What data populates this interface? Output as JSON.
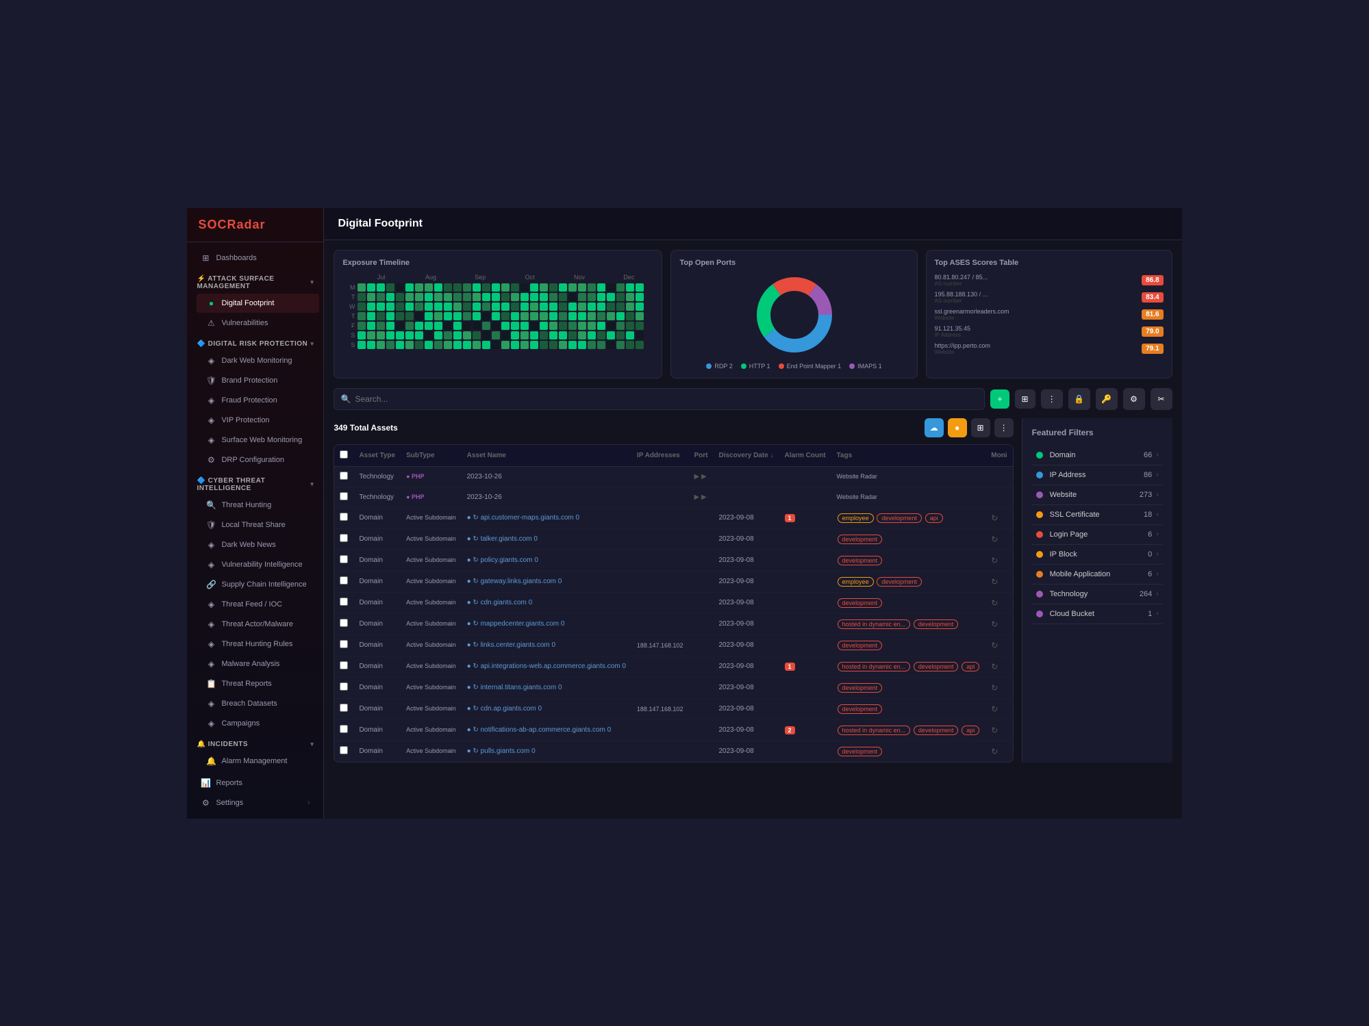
{
  "app": {
    "logo": "SOCRadar",
    "page_title": "Digital Footprint"
  },
  "sidebar": {
    "top_items": [
      {
        "id": "dashboards",
        "label": "Dashboards",
        "icon": "⊞"
      }
    ],
    "sections": [
      {
        "id": "attack-surface",
        "label": "Attack Surface Management",
        "chevron": "▾",
        "items": [
          {
            "id": "digital-footprint",
            "label": "Digital Footprint",
            "active": true
          },
          {
            "id": "vulnerabilities",
            "label": "Vulnerabilities",
            "active": false
          }
        ]
      },
      {
        "id": "digital-risk",
        "label": "Digital Risk Protection",
        "chevron": "▾",
        "items": [
          {
            "id": "dark-web",
            "label": "Dark Web Monitoring",
            "active": false
          },
          {
            "id": "brand",
            "label": "Brand Protection",
            "active": false
          },
          {
            "id": "fraud",
            "label": "Fraud Protection",
            "active": false
          },
          {
            "id": "vip",
            "label": "VIP Protection",
            "active": false
          },
          {
            "id": "surface-web",
            "label": "Surface Web Monitoring",
            "active": false
          },
          {
            "id": "drp-config",
            "label": "DRP Configuration",
            "active": false
          }
        ]
      },
      {
        "id": "cyber-threat",
        "label": "Cyber Threat Intelligence",
        "chevron": "▾",
        "items": [
          {
            "id": "threat-hunting",
            "label": "Threat Hunting",
            "active": false
          },
          {
            "id": "local-threat",
            "label": "Local Threat Share",
            "active": false
          },
          {
            "id": "dark-web-news",
            "label": "Dark Web News",
            "active": false
          },
          {
            "id": "vuln-intel",
            "label": "Vulnerability Intelligence",
            "active": false
          },
          {
            "id": "supply-chain",
            "label": "Supply Chain Intelligence",
            "active": false
          },
          {
            "id": "threat-feed",
            "label": "Threat Feed / IOC",
            "active": false
          },
          {
            "id": "threat-actor",
            "label": "Threat Actor/Malware",
            "active": false
          },
          {
            "id": "hunting-rules",
            "label": "Threat Hunting Rules",
            "active": false
          },
          {
            "id": "malware",
            "label": "Malware Analysis",
            "active": false
          },
          {
            "id": "threat-reports",
            "label": "Threat Reports",
            "active": false
          },
          {
            "id": "breach",
            "label": "Breach Datasets",
            "active": false
          },
          {
            "id": "campaigns",
            "label": "Campaigns",
            "active": false
          }
        ]
      },
      {
        "id": "incidents",
        "label": "Incidents",
        "chevron": "▾",
        "items": [
          {
            "id": "alarm-mgmt",
            "label": "Alarm Management",
            "active": false
          }
        ]
      },
      {
        "id": "reports",
        "label": "Reports",
        "chevron": ""
      },
      {
        "id": "settings",
        "label": "Settings",
        "chevron": "›"
      }
    ]
  },
  "exposure_timeline": {
    "title": "Exposure Timeline",
    "months": [
      "Jul",
      "Aug",
      "Sep",
      "Oct",
      "Nov",
      "Dec"
    ],
    "day_labels": [
      "M",
      "T",
      "W",
      "T",
      "F",
      "S",
      "S"
    ]
  },
  "top_ports": {
    "title": "Top Open Ports",
    "legend": [
      {
        "label": "RDP",
        "value": 2,
        "color": "#3498db"
      },
      {
        "label": "HTTP",
        "value": 1,
        "color": "#00c97a"
      },
      {
        "label": "End Point Mapper",
        "value": 1,
        "color": "#e74c3c"
      },
      {
        "label": "IMAPS",
        "value": 1,
        "color": "#9b59b6"
      }
    ],
    "segments": [
      {
        "color": "#3498db",
        "pct": 40
      },
      {
        "color": "#00c97a",
        "pct": 25
      },
      {
        "color": "#e74c3c",
        "pct": 20
      },
      {
        "color": "#9b59b6",
        "pct": 15
      }
    ]
  },
  "ases_table": {
    "title": "Top ASES Scores Table",
    "items": [
      {
        "address": "80.81.80.247 / 85...",
        "sublabel": "AS number",
        "score": 86.8,
        "color": "#e74c3c"
      },
      {
        "address": "195.88.188.130 / ...",
        "sublabel": "AS number",
        "score": 83.4,
        "color": "#e74c3c"
      },
      {
        "address": "ssl.greenarmorleaders.com",
        "sublabel": "Website",
        "score": 81.6,
        "color": "#e67e22"
      },
      {
        "address": "91.121.35.45",
        "sublabel": "IP Address",
        "score": 79.0,
        "color": "#e67e22"
      },
      {
        "address": "https://ipp.perto.com",
        "sublabel": "Website",
        "score": 79.1,
        "color": "#e67e22"
      }
    ]
  },
  "search": {
    "placeholder": "Search...",
    "btn_labels": {
      "add": "+",
      "filter": "⊞",
      "more": "⋮"
    }
  },
  "assets": {
    "total_label": "349 Total Assets",
    "columns": [
      "",
      "Asset Type",
      "SubType",
      "Asset Name",
      "IP Addresses",
      "Port",
      "Discovery Date ↓",
      "Alarm Count",
      "Tags",
      "Moni"
    ],
    "rows": [
      {
        "type": "Technology",
        "subtype": "● PHP",
        "name": "2023-10-26",
        "ip": "",
        "port": "",
        "date": "",
        "alarm": "",
        "tags": [
          "Website Radar"
        ],
        "source": ""
      },
      {
        "type": "Technology",
        "subtype": "● PHP",
        "name": "2023-10-26",
        "ip": "",
        "port": "",
        "date": "",
        "alarm": "",
        "tags": [
          "Website Radar"
        ],
        "source": ""
      },
      {
        "type": "Domain",
        "subtype": "Active Subdomain",
        "name": "api.customer-maps.giants.com 0",
        "ip": "",
        "port": "",
        "date": "2023-09-08",
        "alarm": "1",
        "alarm_color": "red",
        "tags": [
          "employee",
          "development",
          "api"
        ],
        "source": ""
      },
      {
        "type": "Domain",
        "subtype": "Active Subdomain",
        "name": "talker.giants.com 0",
        "ip": "",
        "port": "",
        "date": "2023-09-08",
        "alarm": "",
        "tags": [
          "development"
        ],
        "source": ""
      },
      {
        "type": "Domain",
        "subtype": "Active Subdomain",
        "name": "policy.giants.com 0",
        "ip": "",
        "port": "",
        "date": "2023-09-08",
        "alarm": "",
        "tags": [
          "development"
        ],
        "source": ""
      },
      {
        "type": "Domain",
        "subtype": "Active Subdomain",
        "name": "gateway.links.giants.com 0",
        "ip": "",
        "port": "",
        "date": "2023-09-08",
        "alarm": "",
        "tags": [
          "employee",
          "development"
        ],
        "source": ""
      },
      {
        "type": "Domain",
        "subtype": "Active Subdomain",
        "name": "cdn.giants.com 0",
        "ip": "",
        "port": "",
        "date": "2023-09-08",
        "alarm": "",
        "tags": [
          "development"
        ],
        "source": ""
      },
      {
        "type": "Domain",
        "subtype": "Active Subdomain",
        "name": "mappedcenter.giants.com 0",
        "ip": "",
        "port": "",
        "date": "2023-09-08",
        "alarm": "",
        "tags": [
          "hosted in dynamic en...",
          "development"
        ],
        "source": ""
      },
      {
        "type": "Domain",
        "subtype": "Active Subdomain",
        "name": "links.center.giants.com 0",
        "ip": "188.147.168.102",
        "port": "",
        "date": "2023-09-08",
        "alarm": "",
        "tags": [
          "development"
        ],
        "source": ""
      },
      {
        "type": "Domain",
        "subtype": "Active Subdomain",
        "name": "api.integrations-web.ap.commerce.giants.com 0",
        "ip": "",
        "port": "",
        "date": "2023-09-08",
        "alarm": "1",
        "alarm_color": "red",
        "tags": [
          "hosted in dynamic en...",
          "development",
          "api"
        ],
        "source": ""
      },
      {
        "type": "Domain",
        "subtype": "Active Subdomain",
        "name": "internal.titans.giants.com 0",
        "ip": "",
        "port": "",
        "date": "2023-09-08",
        "alarm": "",
        "tags": [
          "development"
        ],
        "source": ""
      },
      {
        "type": "Domain",
        "subtype": "Active Subdomain",
        "name": "cdn.ap.giants.com 0",
        "ip": "188.147.168.102",
        "port": "",
        "date": "2023-09-08",
        "alarm": "",
        "tags": [
          "development"
        ],
        "source": ""
      },
      {
        "type": "Domain",
        "subtype": "Active Subdomain",
        "name": "notifications-ab-ap.commerce.giants.com 0",
        "ip": "",
        "port": "",
        "date": "2023-09-08",
        "alarm": "2",
        "alarm_color": "red",
        "tags": [
          "hosted in dynamic en...",
          "development",
          "api"
        ],
        "source": ""
      },
      {
        "type": "Domain",
        "subtype": "Active Subdomain",
        "name": "pulls.giants.com 0",
        "ip": "",
        "port": "",
        "date": "2023-09-08",
        "alarm": "",
        "tags": [
          "development"
        ],
        "source": ""
      }
    ]
  },
  "featured_filters": {
    "title": "Featured Filters",
    "items": [
      {
        "label": "Domain",
        "count": 66,
        "color": "#00c97a"
      },
      {
        "label": "IP Address",
        "count": 86,
        "color": "#3498db"
      },
      {
        "label": "Website",
        "count": 273,
        "color": "#9b59b6"
      },
      {
        "label": "SSL Certificate",
        "count": 18,
        "color": "#f39c12"
      },
      {
        "label": "Login Page",
        "count": 6,
        "color": "#e74c3c"
      },
      {
        "label": "IP Block",
        "count": 0,
        "color": "#f39c12"
      },
      {
        "label": "Mobile Application",
        "count": 6,
        "color": "#e67e22"
      },
      {
        "label": "Technology",
        "count": 264,
        "color": "#9b59b6"
      },
      {
        "label": "Cloud Bucket",
        "count": 1,
        "color": "#9b59b6"
      }
    ]
  }
}
